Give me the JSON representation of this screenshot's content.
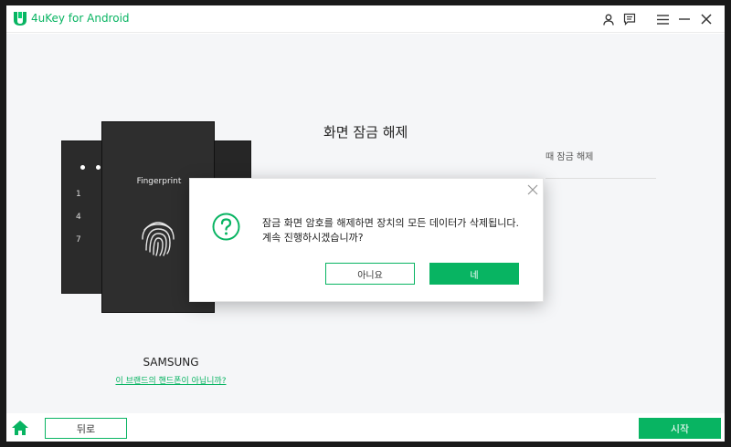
{
  "app": {
    "title": "4uKey for Android",
    "accent_color": "#08b462",
    "icons": [
      "account-icon",
      "feedback-icon",
      "menu-icon",
      "minimize-icon",
      "close-icon"
    ]
  },
  "main": {
    "section_title": "화면 잠금 해제",
    "partial_text": "때 잠금 해제",
    "phone": {
      "fingerprint_label": "Fingerprint",
      "pin_keys": [
        "1",
        "4",
        "7"
      ]
    },
    "brand": {
      "name": "SAMSUNG",
      "link": "이 브랜드의 핸드폰이 아닙니까?"
    }
  },
  "dialog": {
    "message": "잠금 화면 암호를 해제하면 장치의 모든 데이터가 삭제됩니다. 계속 진행하시겠습니까?",
    "cancel_label": "아니요",
    "confirm_label": "네"
  },
  "footer": {
    "back_label": "뒤로",
    "start_label": "시작"
  }
}
